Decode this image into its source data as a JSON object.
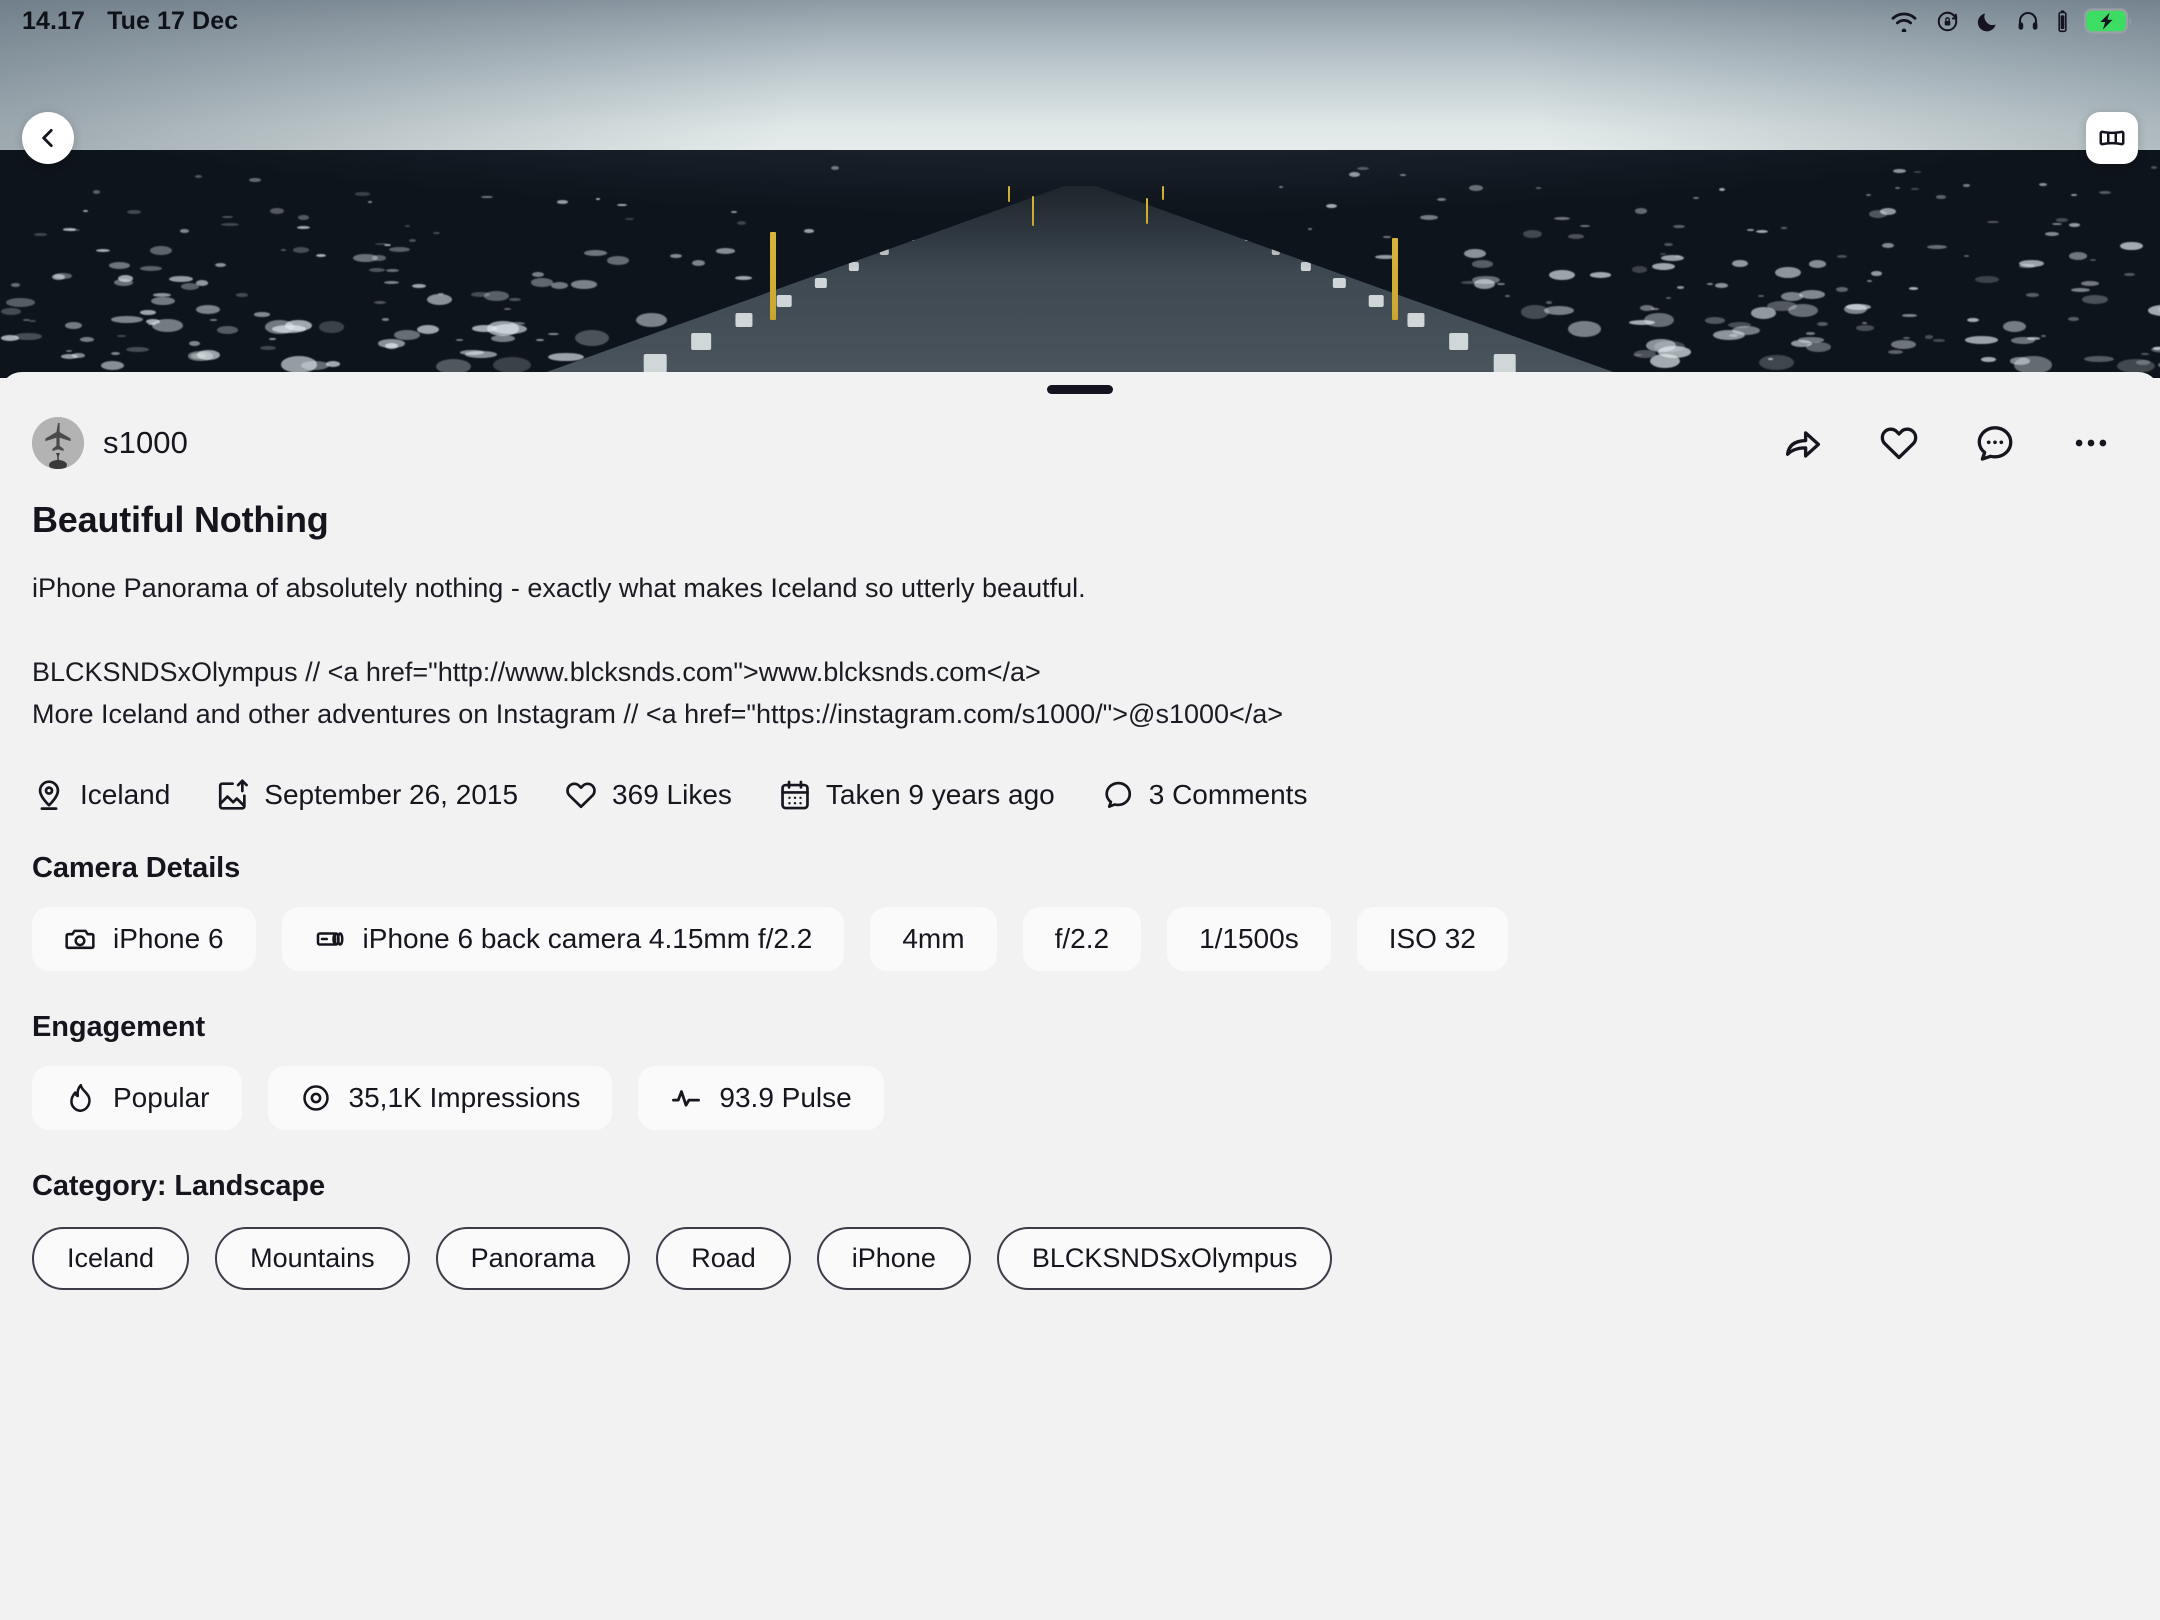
{
  "status_bar": {
    "time": "14.17",
    "date": "Tue 17 Dec",
    "icons": [
      "wifi-icon",
      "rotation-lock-icon",
      "do-not-disturb-moon-icon",
      "headphones-icon",
      "headphone-battery-icon",
      "battery-charging-icon"
    ],
    "battery_color": "#3ddc62"
  },
  "hero": {
    "back_button": "chevron-left-icon",
    "panorama_button": "panorama-icon",
    "alt": "Panoramic photo of an empty road through black Icelandic lava fields with snowy mountains on the horizon"
  },
  "sheet": {
    "author": {
      "name": "s1000",
      "avatar": "airplane-avatar"
    },
    "actions": [
      {
        "name": "share-icon",
        "label": "Share"
      },
      {
        "name": "heart-icon",
        "label": "Like"
      },
      {
        "name": "comment-icon",
        "label": "Comment"
      },
      {
        "name": "more-icon",
        "label": "More"
      }
    ],
    "title": "Beautiful Nothing",
    "description": "iPhone Panorama of absolutely nothing - exactly what makes Iceland so utterly beautful.",
    "links": [
      "BLCKSNDSxOlympus // <a href=\"http://www.blcksnds.com\">www.blcksnds.com</a>",
      "More Iceland and other adventures on Instagram // <a href=\"https://instagram.com/s1000/\">@s1000</a>"
    ],
    "meta": [
      {
        "icon": "location-pin-icon",
        "label": "Iceland"
      },
      {
        "icon": "image-upload-icon",
        "label": "September 26, 2015"
      },
      {
        "icon": "heart-icon",
        "label": "369 Likes"
      },
      {
        "icon": "calendar-icon",
        "label": "Taken 9 years ago"
      },
      {
        "icon": "comment-bubble-icon",
        "label": "3 Comments"
      }
    ],
    "camera_details": {
      "heading": "Camera Details",
      "chips": [
        {
          "icon": "camera-icon",
          "label": "iPhone 6"
        },
        {
          "icon": "lens-icon",
          "label": "iPhone 6 back camera 4.15mm f/2.2"
        },
        {
          "icon": "",
          "label": "4mm"
        },
        {
          "icon": "",
          "label": "f/2.2"
        },
        {
          "icon": "",
          "label": "1/1500s"
        },
        {
          "icon": "",
          "label": "ISO 32"
        }
      ]
    },
    "engagement": {
      "heading": "Engagement",
      "chips": [
        {
          "icon": "flame-icon",
          "label": "Popular"
        },
        {
          "icon": "eye-icon",
          "label": "35,1K Impressions"
        },
        {
          "icon": "pulse-icon",
          "label": "93.9 Pulse"
        }
      ]
    },
    "category": {
      "heading": "Category: Landscape",
      "tags": [
        "Iceland",
        "Mountains",
        "Panorama",
        "Road",
        "iPhone",
        "BLCKSNDSxOlympus"
      ]
    }
  },
  "colors": {
    "page_bg": "#f2f2f2",
    "chip_bg": "#fafafa",
    "text": "#17161f",
    "tag_border": "#3c3b47"
  }
}
